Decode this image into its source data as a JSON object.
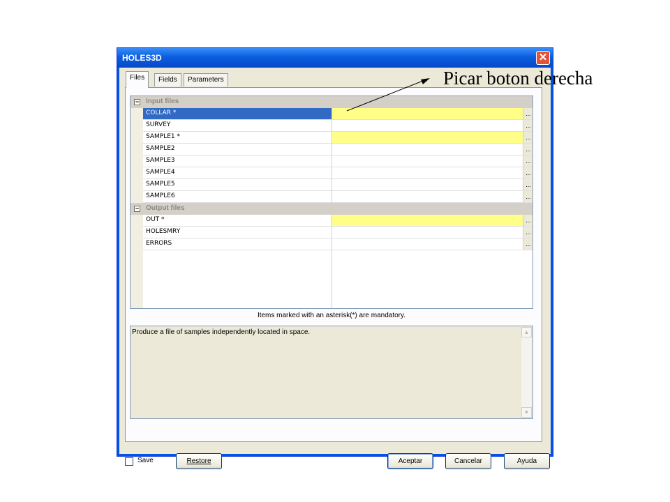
{
  "window": {
    "title": "HOLES3D",
    "close_symbol": "✕"
  },
  "tabs": [
    {
      "label": "Files",
      "active": true
    },
    {
      "label": "Fields",
      "active": false
    },
    {
      "label": "Parameters",
      "active": false
    }
  ],
  "grid": {
    "categories": [
      {
        "label": "Input files",
        "toggle": "−",
        "rows": [
          {
            "name": "COLLAR *",
            "value": "",
            "mandatory": true,
            "selected": true,
            "button": "..."
          },
          {
            "name": "SURVEY",
            "value": "",
            "mandatory": false,
            "selected": false,
            "button": "..."
          },
          {
            "name": "SAMPLE1 *",
            "value": "",
            "mandatory": true,
            "selected": false,
            "button": "..."
          },
          {
            "name": "SAMPLE2",
            "value": "",
            "mandatory": false,
            "selected": false,
            "button": "..."
          },
          {
            "name": "SAMPLE3",
            "value": "",
            "mandatory": false,
            "selected": false,
            "button": "..."
          },
          {
            "name": "SAMPLE4",
            "value": "",
            "mandatory": false,
            "selected": false,
            "button": "..."
          },
          {
            "name": "SAMPLE5",
            "value": "",
            "mandatory": false,
            "selected": false,
            "button": "..."
          },
          {
            "name": "SAMPLE6",
            "value": "",
            "mandatory": false,
            "selected": false,
            "button": "..."
          }
        ]
      },
      {
        "label": "Output files",
        "toggle": "−",
        "rows": [
          {
            "name": "OUT *",
            "value": "",
            "mandatory": true,
            "selected": false,
            "button": "..."
          },
          {
            "name": "HOLESMRY",
            "value": "",
            "mandatory": false,
            "selected": false,
            "button": "..."
          },
          {
            "name": "ERRORS",
            "value": "",
            "mandatory": false,
            "selected": false,
            "button": "..."
          }
        ]
      }
    ]
  },
  "note": "Items marked with an asterisk(*) are mandatory.",
  "description": "Produce a file of samples independently located in space.",
  "scroll": {
    "up": "▲",
    "down": "▼"
  },
  "footer": {
    "save_label": "Save",
    "save_checked": false,
    "restore_label": "Restore",
    "ok_label": "Aceptar",
    "cancel_label": "Cancelar",
    "help_label": "Ayuda"
  },
  "annotation": "Picar boton derecha",
  "colors": {
    "selection": "#316ac5",
    "mandatory": "#ffff88",
    "titlebar": "#0a5fe0",
    "dialog": "#ece9d8"
  }
}
